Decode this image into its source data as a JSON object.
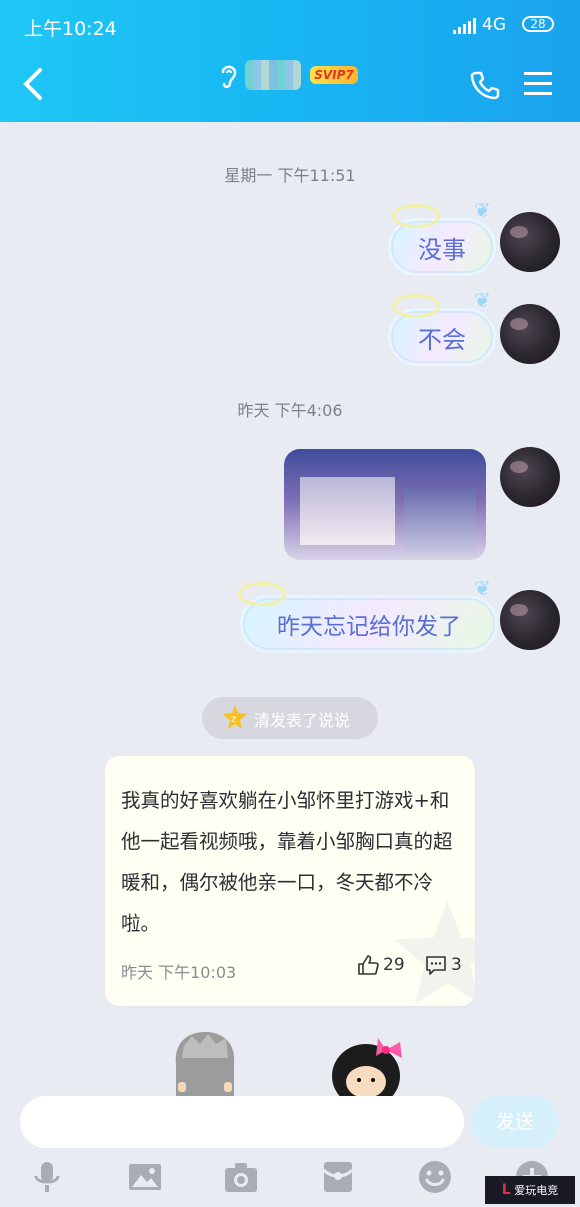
{
  "status_bar": {
    "time": "上午10:24",
    "network": "4G",
    "battery": "28"
  },
  "header": {
    "badge": "SVIP7"
  },
  "messages": [
    {
      "type": "time",
      "text": "星期一 下午11:51"
    },
    {
      "type": "sent_text",
      "text": "没事"
    },
    {
      "type": "sent_text",
      "text": "不会"
    },
    {
      "type": "time",
      "text": "昨天 下午4:06"
    },
    {
      "type": "sent_image"
    },
    {
      "type": "sent_text",
      "text": "昨天忘记给你发了"
    }
  ],
  "qzone_prompt": {
    "text": "清发表了说说"
  },
  "post": {
    "text": "我真的好喜欢躺在小邹怀里打游戏+和他一起看视频哦，靠着小邹胸口真的超暖和，偶尔被他亲一口，冬天都不冷啦。",
    "time": "昨天 下午10:03",
    "likes": "29",
    "comments": "3"
  },
  "composer": {
    "send_label": "发送"
  },
  "toolbar": {
    "icons": [
      "microphone-icon",
      "image-icon",
      "camera-icon",
      "red-packet-icon",
      "emoji-icon",
      "plus-icon"
    ]
  },
  "watermark": {
    "text": "爱玩电竞"
  },
  "colors": {
    "header": "#1aa3ee",
    "background": "#e9ebf3",
    "bubble_text": "#5a6fd4"
  }
}
